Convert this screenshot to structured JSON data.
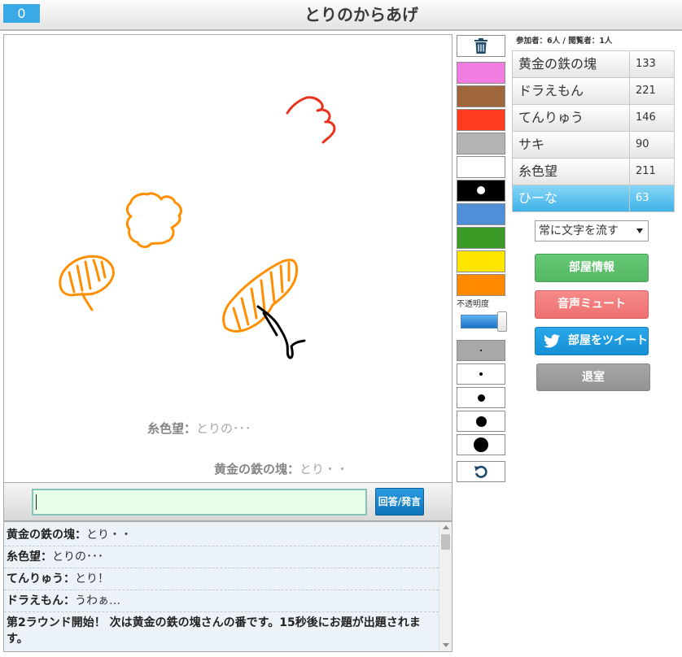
{
  "header": {
    "score": "0",
    "title": "とりのからあげ"
  },
  "name_separator": "：",
  "canvas": {
    "overlay_messages": [
      {
        "name": "糸色望",
        "text": "とりの･･･"
      },
      {
        "name": "黄金の鉄の塊",
        "text": "とり・・"
      }
    ]
  },
  "answer_bar": {
    "input_value": "",
    "submit_label": "回答/発言"
  },
  "chat": {
    "messages": [
      {
        "name": "黄金の鉄の塊",
        "text": "とり・・"
      },
      {
        "name": "糸色望",
        "text": "とりの･･･"
      },
      {
        "name": "てんりゅう",
        "text": "とり！"
      },
      {
        "name": "ドラえもん",
        "text": "うわぁ…"
      }
    ],
    "system_message": "第2ラウンド開始！ 次は黄金の鉄の塊さんの番です。15秒後にお題が出題されます。"
  },
  "tools": {
    "clear_icon": "trash-icon",
    "palette": [
      "#f07ddf",
      "#a0663c",
      "#ff3c1f",
      "#b4b4b4",
      "#ffffff",
      "#000000",
      "#4e8fd8",
      "#3a9c27",
      "#ffe500",
      "#ff8a00"
    ],
    "selected_color_index": 5,
    "opacity_label": "不透明度",
    "opacity": 1.0,
    "selected_brush_index": 0,
    "undo_icon": "undo-icon"
  },
  "sidebar": {
    "counts": "参加者：6人 / 閲覧者：1人",
    "players": [
      {
        "name": "黄金の鉄の塊",
        "score": "133"
      },
      {
        "name": "ドラえもん",
        "score": "221"
      },
      {
        "name": "てんりゅう",
        "score": "146"
      },
      {
        "name": "サキ",
        "score": "90"
      },
      {
        "name": "糸色望",
        "score": "211"
      },
      {
        "name": "ひーな",
        "score": "63"
      }
    ],
    "current_player_index": 5,
    "text_flow_select": "常に文字を流す",
    "tweet_icon": "twitter-bird-icon",
    "buttons": {
      "room_info": "部屋情報",
      "mute": "音声ミュート",
      "tweet": "部屋をツイート",
      "leave": "退室"
    }
  }
}
